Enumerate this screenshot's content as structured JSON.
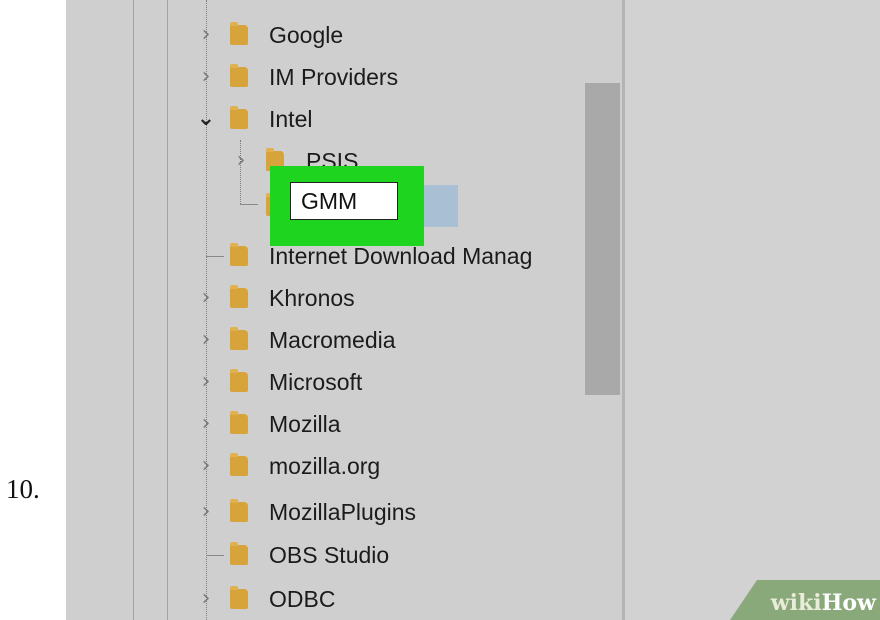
{
  "step_number": "10.",
  "tree": {
    "items": [
      {
        "label": "Google",
        "expander": "collapsed"
      },
      {
        "label": "IM Providers",
        "expander": "collapsed"
      },
      {
        "label": "Intel",
        "expander": "expanded"
      },
      {
        "label": "PSIS",
        "expander": "collapsed"
      },
      {
        "label": "Internet Download Manag",
        "expander": "none"
      },
      {
        "label": "Khronos",
        "expander": "collapsed"
      },
      {
        "label": "Macromedia",
        "expander": "collapsed"
      },
      {
        "label": "Microsoft",
        "expander": "collapsed"
      },
      {
        "label": "Mozilla",
        "expander": "collapsed"
      },
      {
        "label": "mozilla.org",
        "expander": "collapsed"
      },
      {
        "label": "MozillaPlugins",
        "expander": "collapsed"
      },
      {
        "label": "OBS Studio",
        "expander": "none"
      },
      {
        "label": "ODBC",
        "expander": "collapsed"
      }
    ],
    "rename_value": "GMM"
  },
  "watermark": {
    "part1": "wiki",
    "part2": "How"
  },
  "colors": {
    "highlight": "#1ed41e",
    "folder": "#d7a33b",
    "selection": "#a9bfd4"
  }
}
